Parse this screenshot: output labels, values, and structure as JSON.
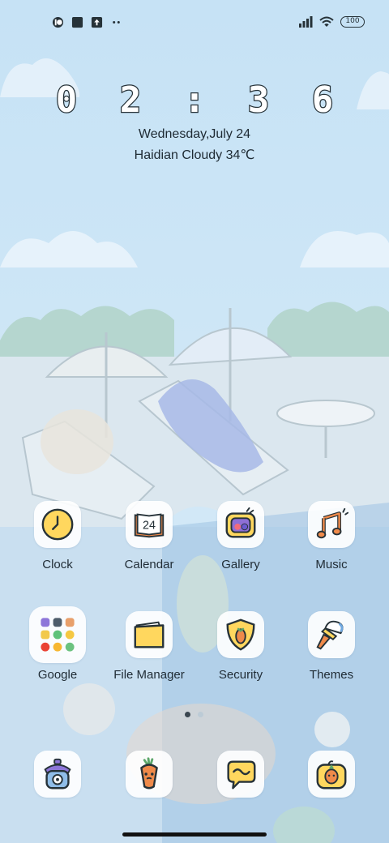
{
  "status_bar": {
    "left_icons": [
      "app-notification-icon",
      "square-notification-icon",
      "upload-icon",
      "more-dots-icon"
    ],
    "right_icons": [
      "signal-icon",
      "wifi-icon",
      "battery-icon"
    ],
    "battery_level": "100"
  },
  "clock": {
    "time": "0 2 : 3 6",
    "date": "Wednesday,July 24",
    "weather": "Haidian Cloudy 34℃"
  },
  "apps": {
    "row1": [
      {
        "label": "Clock",
        "icon": "clock-icon"
      },
      {
        "label": "Calendar",
        "icon": "calendar-icon",
        "badge": "24"
      },
      {
        "label": "Gallery",
        "icon": "gallery-icon"
      },
      {
        "label": "Music",
        "icon": "music-note-icon"
      }
    ],
    "row2": [
      {
        "label": "Google",
        "icon": "google-folder-icon"
      },
      {
        "label": "File Manager",
        "icon": "folder-icon"
      },
      {
        "label": "Security",
        "icon": "shield-icon"
      },
      {
        "label": "Themes",
        "icon": "paintbrush-icon"
      }
    ],
    "dock": [
      {
        "icon": "phone-icon"
      },
      {
        "icon": "carrot-messaging-icon"
      },
      {
        "icon": "chat-bubble-icon"
      },
      {
        "icon": "carrot-camera-icon"
      }
    ]
  },
  "page_indicator": {
    "pages": 2,
    "current": 1
  },
  "colors": {
    "sky": "#cfe6f7",
    "icon_yellow": "#ffd75e",
    "icon_orange": "#ef8a4a",
    "outline": "#263238"
  }
}
